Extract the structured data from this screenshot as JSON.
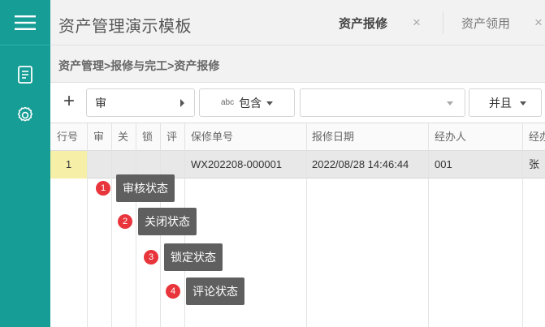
{
  "app": {
    "title": "资产管理演示模板"
  },
  "tabs": [
    {
      "label": "资产报修",
      "active": true
    },
    {
      "label": "资产领用",
      "active": false
    }
  ],
  "breadcrumb": "资产管理>报修与完工>资产报修",
  "toolbar": {
    "add": "+",
    "field_value": "审",
    "operator_prefix": "abc",
    "operator_label": "包含",
    "value": "",
    "logic_label": "并且"
  },
  "grid": {
    "headers": [
      "行号",
      "审",
      "关",
      "锁",
      "评",
      "保修单号",
      "报修日期",
      "经办人",
      "经办"
    ],
    "rows": [
      {
        "row_no": "1",
        "audit": "",
        "closed": "",
        "locked": "",
        "review": "",
        "order_no": "WX202208-000001",
        "date": "2022/08/28 14:46:44",
        "handler": "001",
        "extra": "张"
      }
    ]
  },
  "callouts": [
    {
      "num": "1",
      "label": "审核状态"
    },
    {
      "num": "2",
      "label": "关闭状态"
    },
    {
      "num": "3",
      "label": "锁定状态"
    },
    {
      "num": "4",
      "label": "评论状态"
    }
  ],
  "colors": {
    "sidebar": "#169d95",
    "badge": "#e8353b",
    "row_highlight": "#f5efa7",
    "tooltip": "#5f5f5f"
  }
}
